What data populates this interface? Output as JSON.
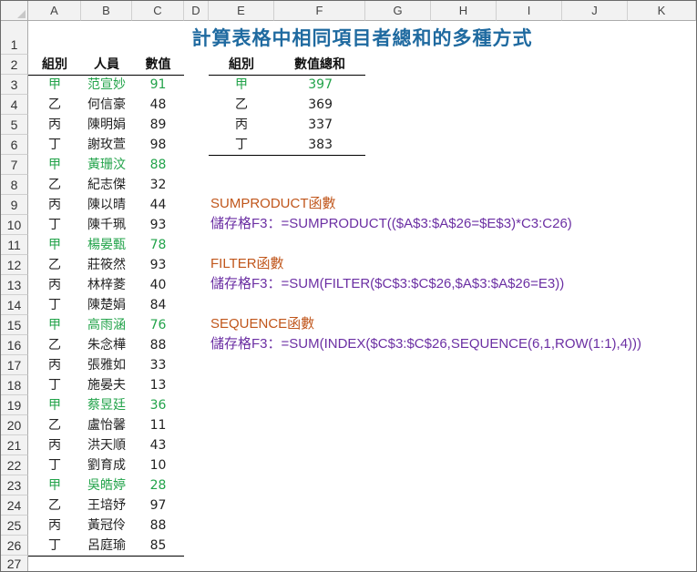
{
  "columns": [
    "A",
    "B",
    "C",
    "D",
    "E",
    "F",
    "G",
    "H",
    "I",
    "J",
    "K"
  ],
  "rows": [
    "1",
    "2",
    "3",
    "4",
    "5",
    "6",
    "7",
    "8",
    "9",
    "10",
    "11",
    "12",
    "13",
    "14",
    "15",
    "16",
    "17",
    "18",
    "19",
    "20",
    "21",
    "22",
    "23",
    "24",
    "25",
    "26",
    "27"
  ],
  "title": "計算表格中相同項目者總和的多種方式",
  "table": {
    "headers": [
      "組別",
      "人員",
      "數值"
    ],
    "rows": [
      {
        "group": "甲",
        "name": "范宣妙",
        "value": "91"
      },
      {
        "group": "乙",
        "name": "何信豪",
        "value": "48"
      },
      {
        "group": "丙",
        "name": "陳明娟",
        "value": "89"
      },
      {
        "group": "丁",
        "name": "謝玫萱",
        "value": "98"
      },
      {
        "group": "甲",
        "name": "黃珊汶",
        "value": "88"
      },
      {
        "group": "乙",
        "name": "紀志傑",
        "value": "32"
      },
      {
        "group": "丙",
        "name": "陳以晴",
        "value": "44"
      },
      {
        "group": "丁",
        "name": "陳千珮",
        "value": "93"
      },
      {
        "group": "甲",
        "name": "楊晏甄",
        "value": "78"
      },
      {
        "group": "乙",
        "name": "莊筱然",
        "value": "93"
      },
      {
        "group": "丙",
        "name": "林梓菱",
        "value": "40"
      },
      {
        "group": "丁",
        "name": "陳楚娟",
        "value": "84"
      },
      {
        "group": "甲",
        "name": "高雨涵",
        "value": "76"
      },
      {
        "group": "乙",
        "name": "朱念樺",
        "value": "88"
      },
      {
        "group": "丙",
        "name": "張雅如",
        "value": "33"
      },
      {
        "group": "丁",
        "name": "施晏夫",
        "value": "13"
      },
      {
        "group": "甲",
        "name": "蔡昱廷",
        "value": "36"
      },
      {
        "group": "乙",
        "name": "盧怡馨",
        "value": "11"
      },
      {
        "group": "丙",
        "name": "洪天順",
        "value": "43"
      },
      {
        "group": "丁",
        "name": "劉育成",
        "value": "10"
      },
      {
        "group": "甲",
        "name": "吳皓婷",
        "value": "28"
      },
      {
        "group": "乙",
        "name": "王培妤",
        "value": "97"
      },
      {
        "group": "丙",
        "name": "黃冠伶",
        "value": "88"
      },
      {
        "group": "丁",
        "name": "呂庭瑜",
        "value": "85"
      }
    ]
  },
  "summary": {
    "headers": [
      "組別",
      "數值總和"
    ],
    "rows": [
      {
        "group": "甲",
        "sum": "397"
      },
      {
        "group": "乙",
        "sum": "369"
      },
      {
        "group": "丙",
        "sum": "337"
      },
      {
        "group": "丁",
        "sum": "383"
      }
    ]
  },
  "methods": [
    {
      "label": "SUMPRODUCT函數",
      "formula": "儲存格F3：=SUMPRODUCT(($A$3:$A$26=$E$3)*C3:C26)"
    },
    {
      "label": "FILTER函數",
      "formula": "儲存格F3：=SUM(FILTER($C$3:$C$26,$A$3:$A$26=E3))"
    },
    {
      "label": "SEQUENCE函數",
      "formula": "儲存格F3：=SUM(INDEX($C$3:$C$26,SEQUENCE(6,1,ROW(1:1),4)))"
    }
  ],
  "colors": {
    "title": "#1f6aa0",
    "highlight": "#22a34a",
    "method_label": "#c0561b",
    "formula": "#6b2fa3"
  }
}
